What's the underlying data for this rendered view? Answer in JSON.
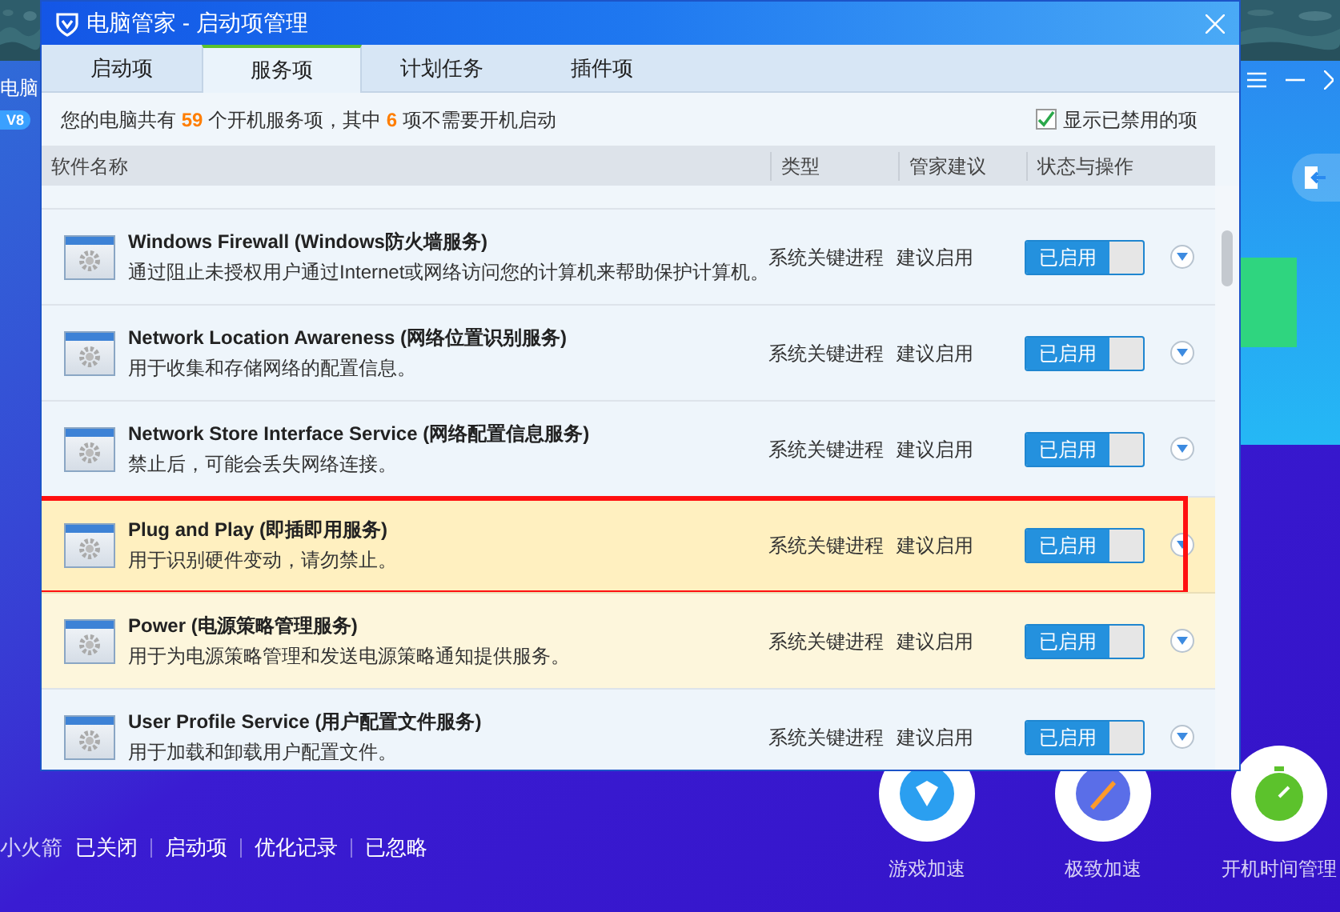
{
  "background_app": {
    "brand": "电脑",
    "version_badge": "V8",
    "rocket_label": "小火箭",
    "rocket_status": "已关闭",
    "links": [
      "启动项",
      "优化记录",
      "已忽略"
    ],
    "tools": [
      {
        "label": "游戏加速"
      },
      {
        "label": "极致加速"
      },
      {
        "label": "开机时间管理"
      }
    ]
  },
  "window": {
    "title": "电脑管家 - 启动项管理"
  },
  "tabs": [
    {
      "label": "启动项",
      "selected": false
    },
    {
      "label": "服务项",
      "selected": true
    },
    {
      "label": "计划任务",
      "selected": false
    },
    {
      "label": "插件项",
      "selected": false
    }
  ],
  "summary": {
    "before": "您的电脑共有",
    "total": "59",
    "middle": "个开机服务项，其中",
    "count": "6",
    "after": "项不需要开机启动"
  },
  "show_disabled": {
    "label": "显示已禁用的项",
    "checked": true
  },
  "columns": [
    "软件名称",
    "类型",
    "管家建议",
    "状态与操作"
  ],
  "rows": [
    {
      "name": "Windows Firewall (Windows防火墙服务)",
      "description": "通过阻止未授权用户通过Internet或网络访问您的计算机来帮助保护计算机。",
      "type": "系统关键进程",
      "advice": "建议启用",
      "status": "已启用",
      "enabled": true,
      "selected": false,
      "hovered": false,
      "annotated": false
    },
    {
      "name": "Network Location Awareness (网络位置识别服务)",
      "description": "用于收集和存储网络的配置信息。",
      "type": "系统关键进程",
      "advice": "建议启用",
      "status": "已启用",
      "enabled": true,
      "selected": false,
      "hovered": false,
      "annotated": false
    },
    {
      "name": "Network Store Interface Service (网络配置信息服务)",
      "description": "禁止后，可能会丢失网络连接。",
      "type": "系统关键进程",
      "advice": "建议启用",
      "status": "已启用",
      "enabled": true,
      "selected": false,
      "hovered": false,
      "annotated": false
    },
    {
      "name": "Plug and Play (即插即用服务)",
      "description": "用于识别硬件变动，请勿禁止。",
      "type": "系统关键进程",
      "advice": "建议启用",
      "status": "已启用",
      "enabled": true,
      "selected": true,
      "hovered": false,
      "annotated": true
    },
    {
      "name": "Power (电源策略管理服务)",
      "description": "用于为电源策略管理和发送电源策略通知提供服务。",
      "type": "系统关键进程",
      "advice": "建议启用",
      "status": "已启用",
      "enabled": true,
      "selected": false,
      "hovered": true,
      "annotated": false
    },
    {
      "name": "User Profile Service (用户配置文件服务)",
      "description": "用于加载和卸载用户配置文件。",
      "type": "系统关键进程",
      "advice": "建议启用",
      "status": "已启用",
      "enabled": true,
      "selected": false,
      "hovered": false,
      "annotated": false
    }
  ]
}
